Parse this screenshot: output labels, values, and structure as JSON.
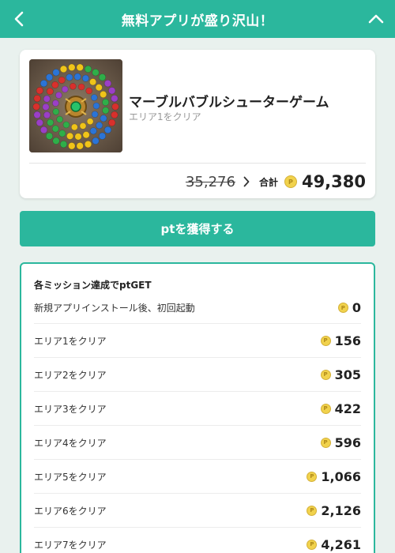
{
  "header": {
    "title": "無料アプリが盛り沢山！",
    "back_icon": "chevron-left-icon",
    "collapse_icon": "chevron-up-icon"
  },
  "app": {
    "name": "マーブルバブルシューターゲーム",
    "subtitle": "エリア1をクリア",
    "old_price": "35,276",
    "total_label": "合計",
    "total_value": "49,380",
    "coin_letter": "P"
  },
  "cta": {
    "label": "ptを獲得する"
  },
  "missions": {
    "heading": "各ミッション達成でptGET",
    "items": [
      {
        "label": "新規アプリインストール後、初回起動",
        "points": "0"
      },
      {
        "label": "エリア1をクリア",
        "points": "156"
      },
      {
        "label": "エリア2をクリア",
        "points": "305"
      },
      {
        "label": "エリア3をクリア",
        "points": "422"
      },
      {
        "label": "エリア4をクリア",
        "points": "596"
      },
      {
        "label": "エリア5をクリア",
        "points": "1,066"
      },
      {
        "label": "エリア6をクリア",
        "points": "2,126"
      },
      {
        "label": "エリア7をクリア",
        "points": "4,261"
      }
    ]
  },
  "colors": {
    "brand": "#2bb79d",
    "coin": "#f1d24c",
    "background": "#e9f1ee"
  }
}
